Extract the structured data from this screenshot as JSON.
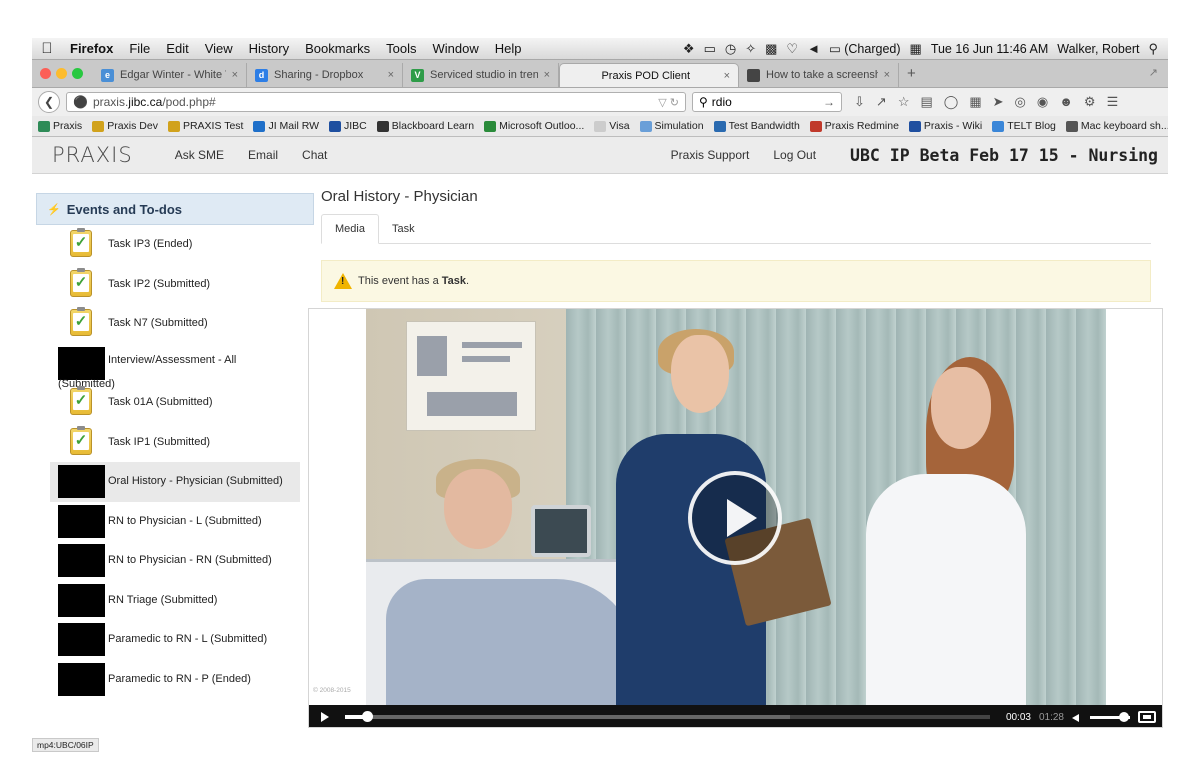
{
  "menubar": {
    "items": [
      "Firefox",
      "File",
      "Edit",
      "View",
      "History",
      "Bookmarks",
      "Tools",
      "Window",
      "Help"
    ],
    "battery": "(Charged)",
    "datetime": "Tue 16 Jun  11:46 AM",
    "user": "Walker, Robert"
  },
  "tabs": [
    {
      "title": "Edgar Winter - White Tras...",
      "color": "#4a8fd6",
      "glyph": "e"
    },
    {
      "title": "Sharing - Dropbox",
      "color": "#2d7ee6",
      "glyph": "d"
    },
    {
      "title": "Serviced studio in trendy ...",
      "color": "#2e9c48",
      "glyph": "V"
    },
    {
      "title": "Praxis POD Client",
      "color": "",
      "glyph": ""
    },
    {
      "title": "How to take a screenshot ...",
      "color": "#444444",
      "glyph": ""
    }
  ],
  "active_tab_index": 3,
  "nav": {
    "url_prefix": "praxis.",
    "url_domain": "jibc.ca",
    "url_path": "/pod.php#",
    "search_value": "rdio"
  },
  "bookmarks": [
    {
      "label": "Praxis",
      "color": "#2e8b57"
    },
    {
      "label": "Praxis Dev",
      "color": "#d1a21c"
    },
    {
      "label": "PRAXIS Test",
      "color": "#d1a21c"
    },
    {
      "label": "JI Mail RW",
      "color": "#1e6fc9"
    },
    {
      "label": "JIBC",
      "color": "#1e4fa0"
    },
    {
      "label": "Blackboard Learn",
      "color": "#333333"
    },
    {
      "label": "Microsoft Outloo...",
      "color": "#2a8b3a"
    },
    {
      "label": "Visa",
      "color": "#cccccc"
    },
    {
      "label": "Simulation",
      "color": "#6a9fd8"
    },
    {
      "label": "Test Bandwidth",
      "color": "#2a6ab0"
    },
    {
      "label": "Praxis Redmine",
      "color": "#c0392b"
    },
    {
      "label": "Praxis - Wiki",
      "color": "#1f4fa0"
    },
    {
      "label": "TELT Blog",
      "color": "#3a86d8"
    },
    {
      "label": "Mac keyboard sh...",
      "color": "#555555"
    }
  ],
  "header": {
    "logo": "PRAXIS",
    "links": [
      "Ask SME",
      "Email",
      "Chat"
    ],
    "support": "Praxis Support",
    "logout": "Log Out",
    "course": "UBC IP Beta Feb 17 15 - Nursing"
  },
  "sidebar": {
    "title": "Events and To-dos",
    "items": [
      {
        "label": "Task IP3 (Ended)",
        "icon": "clipboard-check"
      },
      {
        "label": "Task IP2 (Submitted)",
        "icon": "clipboard-check"
      },
      {
        "label": "Task N7 (Submitted)",
        "icon": "clipboard-check"
      },
      {
        "label": "Interview/Assessment - All",
        "label2": "(Submitted)",
        "icon": "redacted"
      },
      {
        "label": "Task 01A (Submitted)",
        "icon": "clipboard-check"
      },
      {
        "label": "Task IP1 (Submitted)",
        "icon": "clipboard-check"
      },
      {
        "label": "Oral History - Physician (Submitted)",
        "icon": "redacted",
        "selected": true
      },
      {
        "label": "RN to Physician - L (Submitted)",
        "icon": "redacted"
      },
      {
        "label": "RN to Physician - RN (Submitted)",
        "icon": "redacted"
      },
      {
        "label": "RN Triage (Submitted)",
        "icon": "redacted"
      },
      {
        "label": "Paramedic to RN - L (Submitted)",
        "icon": "redacted"
      },
      {
        "label": "Paramedic to RN - P (Ended)",
        "icon": "redacted"
      }
    ]
  },
  "main": {
    "event_title": "Oral History - Physician",
    "tabs": [
      "Media",
      "Task"
    ],
    "notice_prefix": "This event has a ",
    "notice_bold": "Task",
    "notice_suffix": "."
  },
  "video": {
    "copyright": "© 2008-2015",
    "current_time": "00:03",
    "duration": "01:28",
    "progress_fraction": 0.034,
    "buffered_fraction": 0.69,
    "volume_fraction": 0.85
  },
  "statusbar": "mp4:UBC/06IP"
}
